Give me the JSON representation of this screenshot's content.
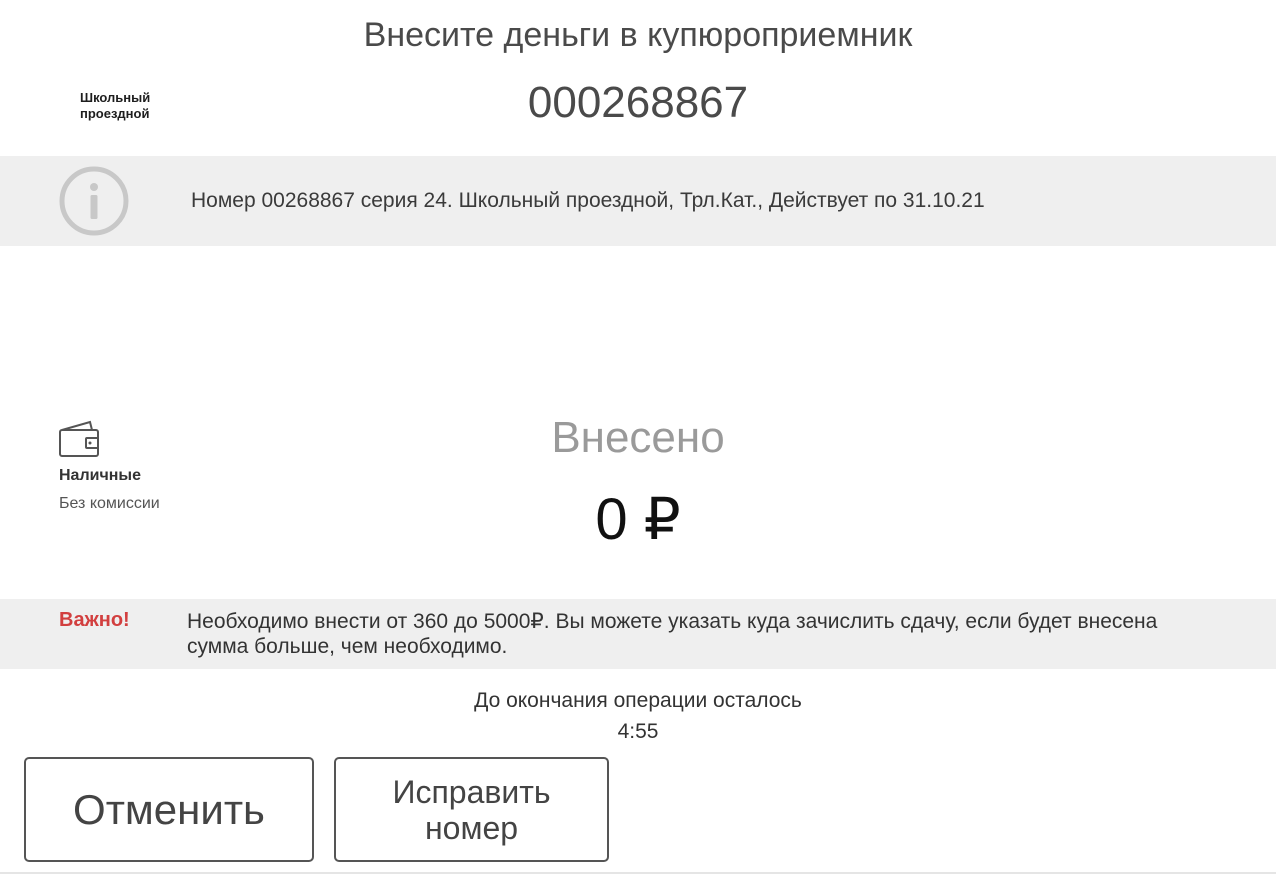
{
  "header": {
    "title": "Внесите деньги в купюроприемник",
    "account_number": "000268867",
    "service_logo_text": "Школьный\nпроездной"
  },
  "info": {
    "icon": "info-icon",
    "text": "Номер 00268867 серия 24. Школьный проездной, Трл.Кат., Действует по 31.10.21"
  },
  "payment": {
    "icon": "wallet-icon",
    "method": "Наличные",
    "fee": "Без комиссии"
  },
  "deposit": {
    "label": "Внесено",
    "amount": "0 ₽"
  },
  "notice": {
    "label": "Важно!",
    "text": "Необходимо внести от 360 до 5000₽. Вы можете указать куда зачислить сдачу, если будет внесена сумма больше, чем необходимо.",
    "label_color": "#d23f3f"
  },
  "timer": {
    "label": "До окончания операции осталось",
    "value": "4:55"
  },
  "buttons": {
    "cancel": "Отменить",
    "edit": "Исправить номер"
  }
}
